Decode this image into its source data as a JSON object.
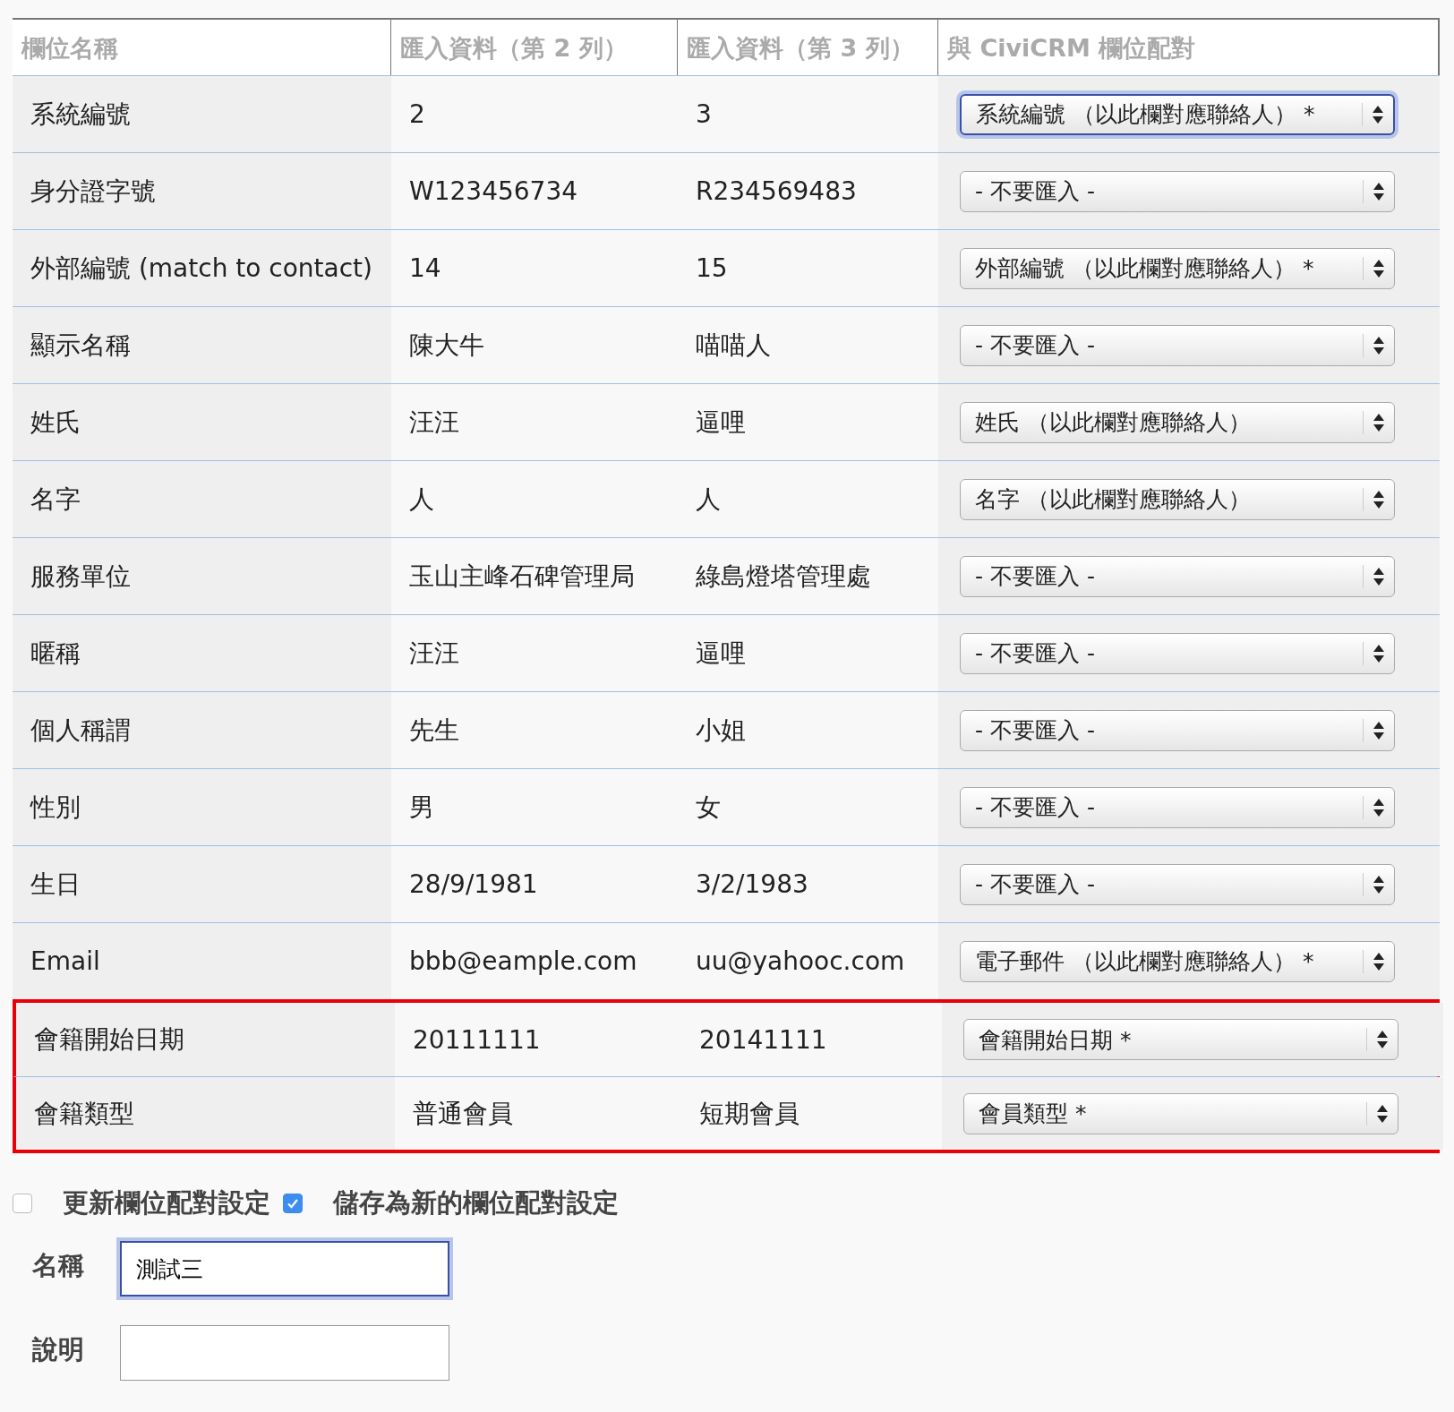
{
  "table": {
    "columns": [
      "欄位名稱",
      "匯入資料（第 2 列）",
      "匯入資料（第 3 列）",
      "與 CiviCRM 欄位配對"
    ],
    "rows": [
      {
        "field": "系統編號",
        "row_2": "2",
        "row_3": "3",
        "mapping": "系統編號 （以此欄對應聯絡人） *",
        "focused": true,
        "highlighted": false
      },
      {
        "field": "身分證字號",
        "row_2": "W123456734",
        "row_3": "R234569483",
        "mapping": "- 不要匯入 -",
        "focused": false,
        "highlighted": false
      },
      {
        "field": "外部編號 (match to contact)",
        "row_2": "14",
        "row_3": "15",
        "mapping": "外部編號 （以此欄對應聯絡人） *",
        "focused": false,
        "highlighted": false
      },
      {
        "field": "顯示名稱",
        "row_2": "陳大牛",
        "row_3": "喵喵人",
        "mapping": "- 不要匯入 -",
        "focused": false,
        "highlighted": false
      },
      {
        "field": "姓氏",
        "row_2": "汪汪",
        "row_3": "逼哩",
        "mapping": "姓氏 （以此欄對應聯絡人）",
        "focused": false,
        "highlighted": false
      },
      {
        "field": "名字",
        "row_2": "人",
        "row_3": "人",
        "mapping": "名字 （以此欄對應聯絡人）",
        "focused": false,
        "highlighted": false
      },
      {
        "field": "服務單位",
        "row_2": "玉山主峰石碑管理局",
        "row_3": "綠島燈塔管理處",
        "mapping": "- 不要匯入 -",
        "focused": false,
        "highlighted": false
      },
      {
        "field": "暱稱",
        "row_2": "汪汪",
        "row_3": "逼哩",
        "mapping": "- 不要匯入 -",
        "focused": false,
        "highlighted": false
      },
      {
        "field": "個人稱謂",
        "row_2": "先生",
        "row_3": "小姐",
        "mapping": "- 不要匯入 -",
        "focused": false,
        "highlighted": false
      },
      {
        "field": "性別",
        "row_2": "男",
        "row_3": "女",
        "mapping": "- 不要匯入 -",
        "focused": false,
        "highlighted": false
      },
      {
        "field": "生日",
        "row_2": "28/9/1981",
        "row_3": "3/2/1983",
        "mapping": "- 不要匯入 -",
        "focused": false,
        "highlighted": false
      },
      {
        "field": "Email",
        "row_2": "bbb@eample.com",
        "row_3": "uu@yahooc.com",
        "mapping": "電子郵件 （以此欄對應聯絡人） *",
        "focused": false,
        "highlighted": false
      },
      {
        "field": "會籍開始日期",
        "row_2": "20111111",
        "row_3": "20141111",
        "mapping": "會籍開始日期 *",
        "focused": false,
        "highlighted": true
      },
      {
        "field": "會籍類型",
        "row_2": "普通會員",
        "row_3": "短期會員",
        "mapping": "會員類型 *",
        "focused": false,
        "highlighted": true
      }
    ]
  },
  "options": [
    {
      "label": "更新欄位配對設定",
      "checked": false
    },
    {
      "label": "儲存為新的欄位配對設定",
      "checked": true
    }
  ],
  "fields": [
    {
      "label": "名稱",
      "value": "測試三",
      "focused": true
    },
    {
      "label": "說明",
      "focused": false
    }
  ]
}
